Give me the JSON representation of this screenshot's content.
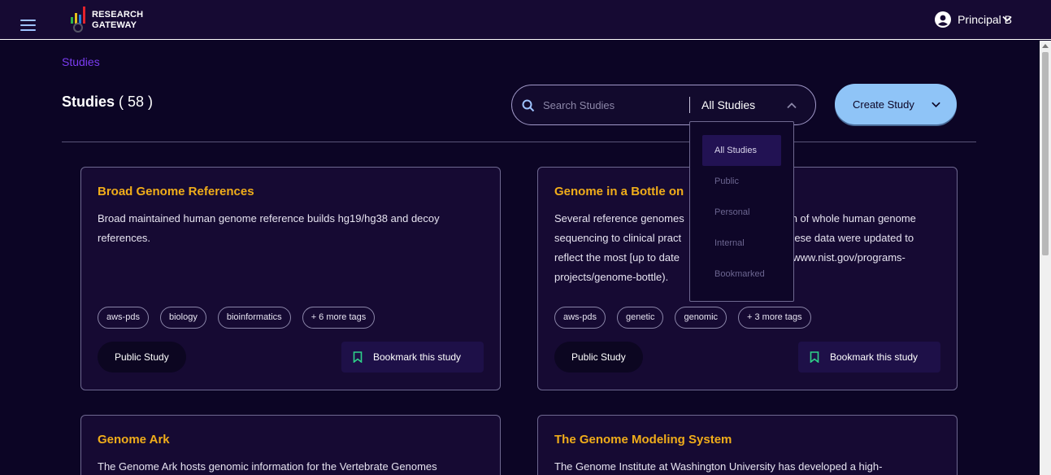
{
  "header": {
    "logo_line1": "RESEARCH",
    "logo_line2": "GATEWAY",
    "user_name": "Principal B",
    "logo_colors": [
      "#2fb34a",
      "#e6c21a",
      "#1e7fd8",
      "#e2232c"
    ]
  },
  "breadcrumb": "Studies",
  "page": {
    "title": "Studies",
    "count": "( 58 )"
  },
  "search": {
    "placeholder": "Search Studies",
    "filter_value": "All Studies"
  },
  "create_button": "Create Study",
  "filter_menu": {
    "items": [
      "All Studies",
      "Public",
      "Personal",
      "Internal",
      "Bookmarked"
    ],
    "selected": "All Studies"
  },
  "cards": [
    {
      "title": "Broad Genome References",
      "description": "Broad maintained human genome reference builds hg19/hg38 and decoy references.",
      "tags": [
        "aws-pds",
        "biology",
        "bioinformatics",
        "+ 6 more tags"
      ],
      "badge": "Public Study",
      "bookmark_label": "Bookmark this study"
    },
    {
      "title": "Genome in a Bottle on",
      "description": "Several reference genomes ... n of whole human genome sequencing to clinical pract ... hese data were updated to reflect the most [up to date ... //www.nist.gov/programs-projects/genome-bottle).",
      "desc_lines": [
        "Several reference genomes",
        "n of whole human genome",
        "sequencing to clinical pract",
        "hese data were updated to",
        "reflect the most [up to date",
        "//www.nist.gov/programs-",
        "projects/genome-bottle)."
      ],
      "tags": [
        "aws-pds",
        "genetic",
        "genomic",
        "+ 3 more tags"
      ],
      "badge": "Public Study",
      "bookmark_label": "Bookmark this study"
    },
    {
      "title": "Genome Ark",
      "description": "The Genome Ark hosts genomic information for the Vertebrate Genomes"
    },
    {
      "title": "The Genome Modeling System",
      "description": "The Genome Institute at Washington University has developed a high-"
    }
  ],
  "colors": {
    "background": "#0c0525",
    "card": "#160a33",
    "title_accent": "#f0ad1a",
    "breadcrumb": "#7b3cf2",
    "create_button": "#8fc4f7",
    "bookmark_icon": "#2fd38a"
  }
}
